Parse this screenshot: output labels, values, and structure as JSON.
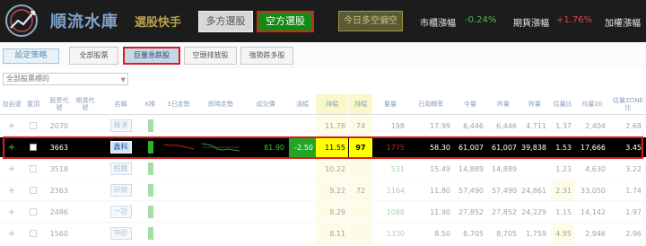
{
  "app": {
    "brand": "順流水庫",
    "subtitle": "選股快手",
    "mode_long": "多方選股",
    "mode_short": "空方選股",
    "sentiment": "今日多空偏空",
    "market_label": "市櫃漲幅",
    "market_value": "-0.24%",
    "futures_label": "期貨漲幅",
    "futures_value": "+1.76%",
    "weighted_label": "加權漲幅"
  },
  "tabs": {
    "strategy": "設定策略",
    "items": [
      "全部股票",
      "巨量急跌股",
      "空頭排放股",
      "強勢跌多股"
    ],
    "active_index": 1
  },
  "filter": {
    "value": "全部股票標的"
  },
  "table": {
    "headers": [
      "加自選",
      "置頂",
      "股票代號",
      "期貨代號",
      "名稱",
      "K棒",
      "3日走勢",
      "即時走勢",
      "成交價",
      "漲幅",
      "排幅",
      "排幅",
      "量量",
      "日周轉率",
      "今量",
      "昨量",
      "昨量",
      "估量比",
      "均量20",
      "估量ZONE比"
    ],
    "rows": [
      {
        "code": "2070",
        "name": "精湛",
        "price": "",
        "change": "",
        "pct": "11.78",
        "rank": "74",
        "vol": "198",
        "turnover": "17.99",
        "today": "6,446",
        "yest": "6,446",
        "prev": "4,711",
        "est": "1.37",
        "avg20": "2,404",
        "zone": "2.68"
      },
      {
        "code": "3663",
        "name": "鑫科",
        "price": "81.90",
        "change": "-2.50",
        "pct": "11.55",
        "rank": "97",
        "vol": "1775",
        "turnover": "58.30",
        "today": "61,007",
        "yest": "61,007",
        "prev": "39,838",
        "est": "1.53",
        "avg20": "17,666",
        "zone": "3.45"
      },
      {
        "code": "3518",
        "name": "柏騰",
        "price": "",
        "change": "",
        "pct": "10.22",
        "rank": "",
        "vol": "531",
        "turnover": "15.49",
        "today": "14,889",
        "yest": "14,889",
        "prev": "",
        "est": "1.23",
        "avg20": "4,630",
        "zone": "3.22"
      },
      {
        "code": "2363",
        "name": "矽統",
        "price": "",
        "change": "",
        "pct": "9.22",
        "rank": "72",
        "vol": "1164",
        "turnover": "11.80",
        "today": "57,490",
        "yest": "57,490",
        "prev": "24,861",
        "est": "2.31",
        "avg20": "33,050",
        "zone": "1.74"
      },
      {
        "code": "2486",
        "name": "一詮",
        "price": "",
        "change": "",
        "pct": "8.29",
        "rank": "",
        "vol": "1088",
        "turnover": "11.90",
        "today": "27,852",
        "yest": "27,852",
        "prev": "24,229",
        "est": "1.15",
        "avg20": "14,142",
        "zone": "1.97"
      },
      {
        "code": "1560",
        "name": "中砂",
        "price": "",
        "change": "",
        "pct": "8.11",
        "rank": "",
        "vol": "1330",
        "turnover": "8.50",
        "today": "8,705",
        "yest": "8,705",
        "prev": "1,759",
        "est": "4.95",
        "avg20": "2,946",
        "zone": "2.96"
      }
    ]
  },
  "colors": {
    "header_bg": "#1c1c1c",
    "accent_red": "#d91d1d",
    "accent_green": "#128a14",
    "highlight_yellow": "#ffff00"
  }
}
